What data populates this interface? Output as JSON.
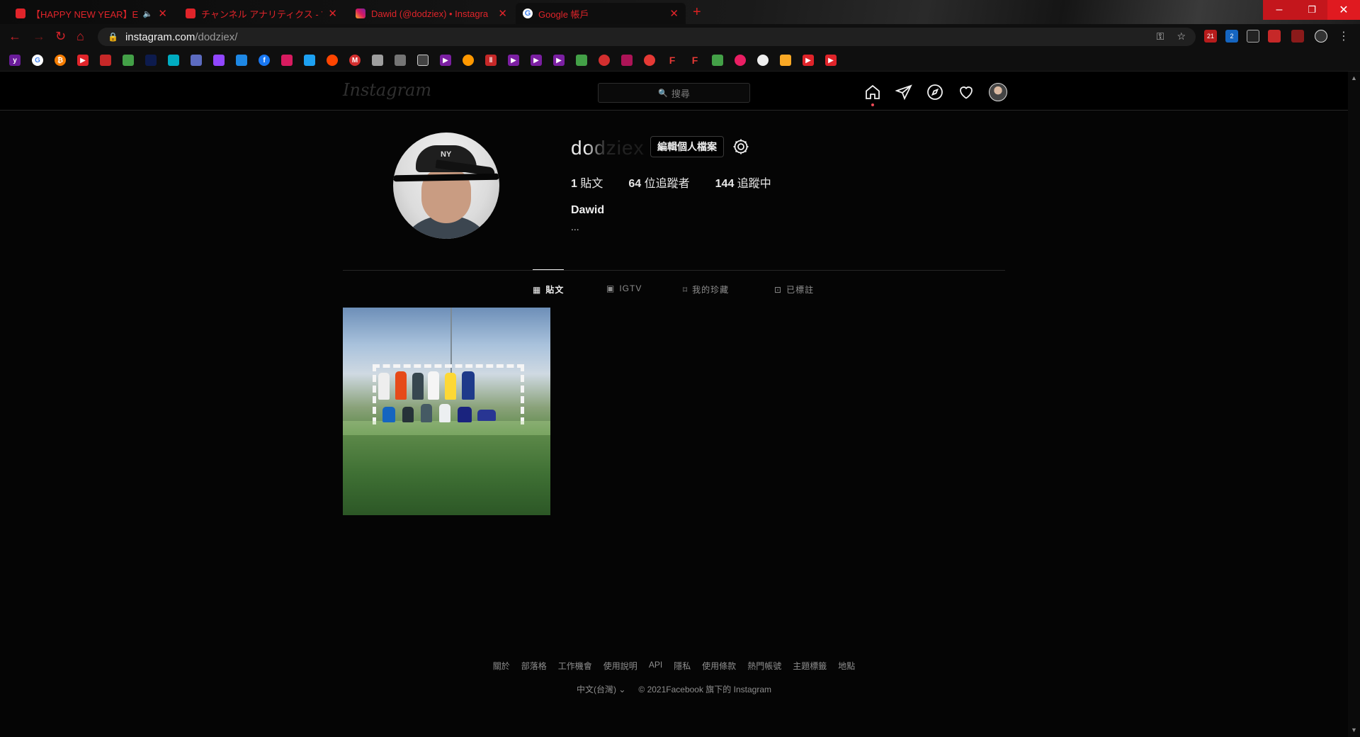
{
  "browser": {
    "tabs": [
      {
        "title": "【HAPPY NEW YEAR】END",
        "favicon": "youtube-icon",
        "audio": true
      },
      {
        "title": "チャンネル アナリティクス - Yo",
        "favicon": "youtube-icon"
      },
      {
        "title": "Dawid (@dodziex) • Instagra",
        "favicon": "instagram-icon",
        "active": true
      },
      {
        "title": "Google 帳戶",
        "favicon": "google-icon"
      }
    ],
    "new_tab": "+",
    "window_controls": {
      "minimize": "–",
      "restore": "❐",
      "close": "✕"
    },
    "address": {
      "host": "instagram.com",
      "path": "/dodziex/"
    },
    "nav": {
      "back": "←",
      "forward": "→",
      "reload": "↻",
      "home": "⌂"
    },
    "extension_badges": {
      "ext1": "21",
      "ext2": "2"
    },
    "accent_color": "#e0242a"
  },
  "instagram": {
    "logo": "Instagram",
    "search_placeholder": "搜尋",
    "profile": {
      "username": "dodziex",
      "edit_button": "編輯個人檔案",
      "posts_count": "1",
      "posts_label": "貼文",
      "followers_count": "64",
      "followers_label": "位追蹤者",
      "following_count": "144",
      "following_label": "追蹤中",
      "full_name": "Dawid",
      "bio": "..."
    },
    "profile_tabs": [
      {
        "label": "貼文",
        "icon": "grid-icon"
      },
      {
        "label": "IGTV",
        "icon": "igtv-icon"
      },
      {
        "label": "我的珍藏",
        "icon": "bookmark-icon"
      },
      {
        "label": "已標註",
        "icon": "tagged-icon"
      }
    ],
    "footer": {
      "links": [
        "關於",
        "部落格",
        "工作機會",
        "使用說明",
        "API",
        "隱私",
        "使用條款",
        "熱門帳號",
        "主題標籤",
        "地點"
      ],
      "language": "中文(台灣)",
      "language_chevron": "⌄",
      "copyright": "© 2021Facebook 旗下的 Instagram"
    }
  }
}
